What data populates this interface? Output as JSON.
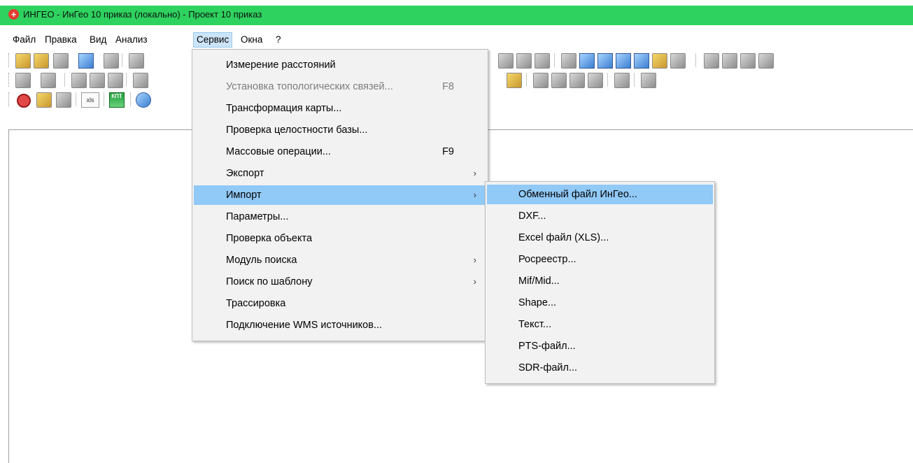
{
  "window": {
    "title": "ИНГЕО - ИнГео 10 приказ (локально) - Проект 10 приказ",
    "icon": "red-plus-icon"
  },
  "menubar": [
    {
      "label": "Файл"
    },
    {
      "label": "Правка"
    },
    {
      "label": "Вид"
    },
    {
      "label": "Анализ"
    },
    {
      "label": "Сервис"
    },
    {
      "label": "Окна"
    },
    {
      "label": "?"
    }
  ],
  "service_menu": [
    {
      "label": "Измерение расстояний",
      "shortcut": "",
      "arrow": "",
      "state": "normal"
    },
    {
      "label": "Установка топологических связей...",
      "shortcut": "F8",
      "arrow": "",
      "state": "disabled"
    },
    {
      "label": "Трансформация карты...",
      "shortcut": "",
      "arrow": "",
      "state": "normal"
    },
    {
      "label": "Проверка целостности базы...",
      "shortcut": "",
      "arrow": "",
      "state": "normal"
    },
    {
      "label": "Массовые операции...",
      "shortcut": "F9",
      "arrow": "",
      "state": "normal"
    },
    {
      "label": "Экспорт",
      "shortcut": "",
      "arrow": "›",
      "state": "normal"
    },
    {
      "label": "Импорт",
      "shortcut": "",
      "arrow": "›",
      "state": "highlighted"
    },
    {
      "label": "Параметры...",
      "shortcut": "",
      "arrow": "",
      "state": "normal"
    },
    {
      "label": "Проверка объекта",
      "shortcut": "",
      "arrow": "",
      "state": "normal"
    },
    {
      "label": "Модуль поиска",
      "shortcut": "",
      "arrow": "›",
      "state": "normal"
    },
    {
      "label": "Поиск по шаблону",
      "shortcut": "",
      "arrow": "›",
      "state": "normal"
    },
    {
      "label": "Трассировка",
      "shortcut": "",
      "arrow": "",
      "state": "normal"
    },
    {
      "label": "Подключение WMS источников...",
      "shortcut": "",
      "arrow": "",
      "state": "normal"
    }
  ],
  "import_menu": [
    {
      "label": "Обменный файл ИнГео...",
      "state": "highlighted"
    },
    {
      "label": "DXF...",
      "state": "normal"
    },
    {
      "label": "Excel файл (XLS)...",
      "state": "normal"
    },
    {
      "label": "Росреестр...",
      "state": "normal"
    },
    {
      "label": "Mif/Mid...",
      "state": "normal"
    },
    {
      "label": "Shape...",
      "state": "normal"
    },
    {
      "label": "Текст...",
      "state": "normal"
    },
    {
      "label": "PTS-файл...",
      "state": "normal"
    },
    {
      "label": "SDR-файл...",
      "state": "normal"
    }
  ],
  "toolbar": {
    "xls_label": "xls",
    "kpt_label": "КПТ"
  },
  "colors": {
    "titlebar": "#2ed25e",
    "highlight": "#91c9f7",
    "menu_bg": "#f2f2f2"
  }
}
